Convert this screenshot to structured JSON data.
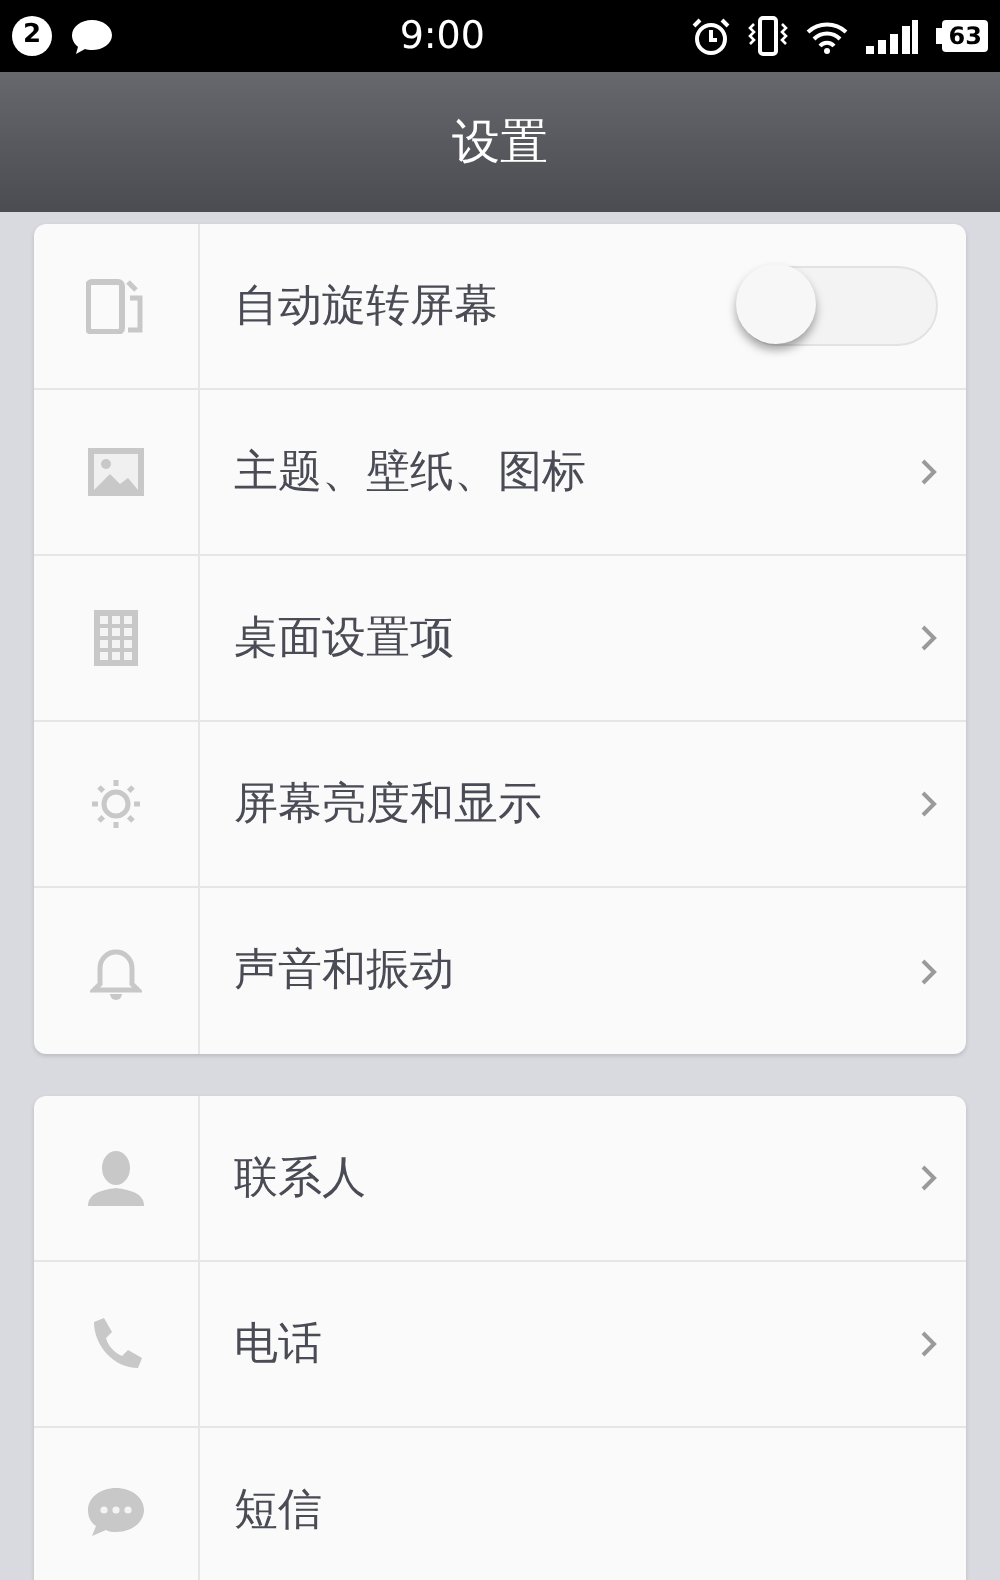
{
  "status_bar": {
    "notification_count": "2",
    "time": "9:00",
    "battery": "63"
  },
  "header": {
    "title": "设置"
  },
  "groups": [
    {
      "items": [
        {
          "kind": "toggle",
          "label": "自动旋转屏幕",
          "on": false
        },
        {
          "kind": "link",
          "label": "主题、壁纸、图标"
        },
        {
          "kind": "link",
          "label": "桌面设置项"
        },
        {
          "kind": "link",
          "label": "屏幕亮度和显示"
        },
        {
          "kind": "link",
          "label": "声音和振动"
        }
      ]
    },
    {
      "items": [
        {
          "kind": "link",
          "label": "联系人"
        },
        {
          "kind": "link",
          "label": "电话"
        },
        {
          "kind": "plain",
          "label": "短信"
        }
      ]
    }
  ]
}
